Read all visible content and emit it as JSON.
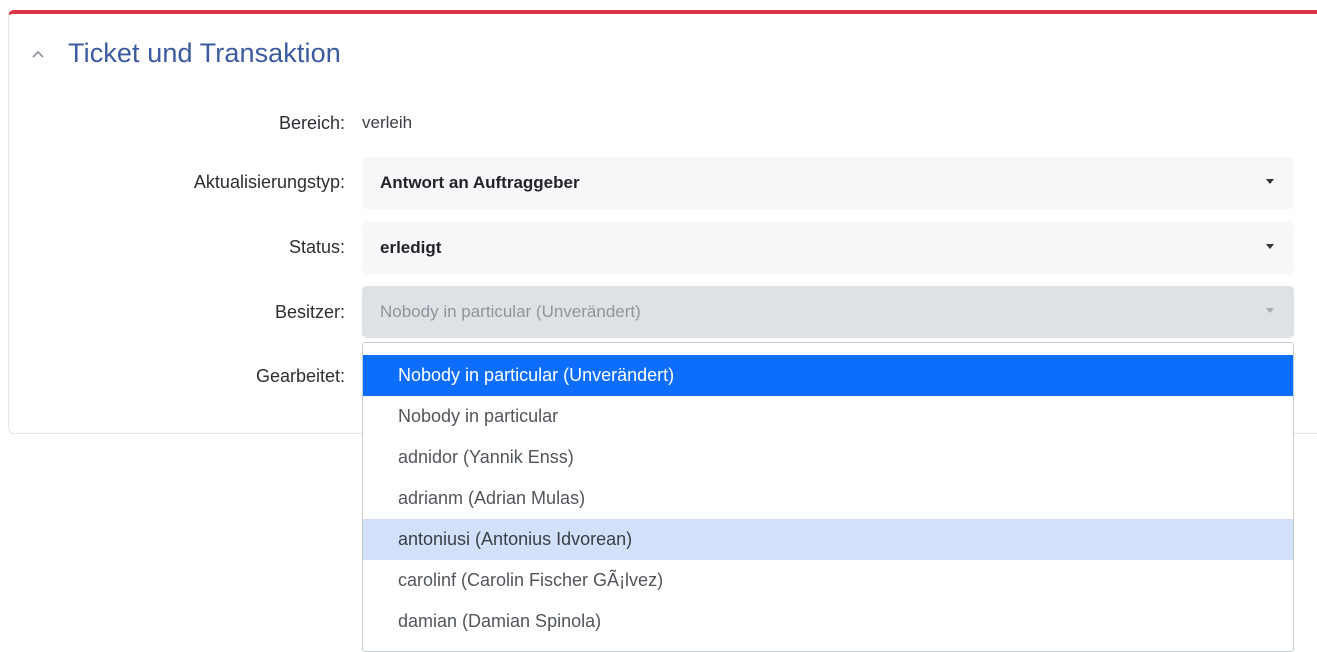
{
  "panel": {
    "title": "Ticket und Transaktion",
    "accent_color": "#dc3545",
    "title_color": "#3c5a9f"
  },
  "fields": {
    "bereich": {
      "label": "Bereich:",
      "value": "verleih"
    },
    "aktualisierungstyp": {
      "label": "Aktualisierungstyp:",
      "value": "Antwort an Auftraggeber"
    },
    "status": {
      "label": "Status:",
      "value": "erledigt"
    },
    "besitzer": {
      "label": "Besitzer:",
      "value": "Nobody in particular (Unverändert)"
    },
    "gearbeitet": {
      "label": "Gearbeitet:"
    }
  },
  "owner_options": [
    {
      "label": "Nobody in particular (Unverändert)",
      "state": "selected"
    },
    {
      "label": "Nobody in particular",
      "state": ""
    },
    {
      "label": "adnidor (Yannik Enss)",
      "state": ""
    },
    {
      "label": "adrianm (Adrian Mulas)",
      "state": ""
    },
    {
      "label": "antoniusi (Antonius Idvorean)",
      "state": "hovered"
    },
    {
      "label": "carolinf (Carolin Fischer GÃ¡lvez)",
      "state": ""
    },
    {
      "label": "damian (Damian Spinola)",
      "state": ""
    }
  ],
  "icons": {
    "collapse": "chevron-up-icon",
    "select_caret": "caret-down-icon"
  },
  "colors": {
    "selected_option": "#0d6efd",
    "hovered_option": "#d3e0fa"
  }
}
